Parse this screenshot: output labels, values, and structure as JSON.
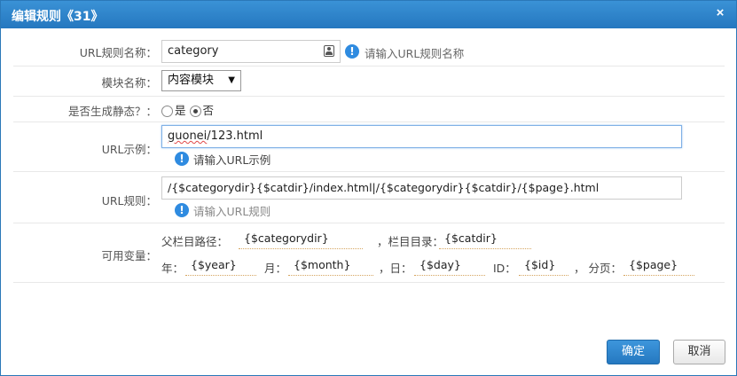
{
  "dialog": {
    "title": "编辑规则《31》",
    "close_label": "×"
  },
  "form": {
    "rule_name": {
      "label": "URL规则名称：",
      "value": "category",
      "hint": "请输入URL规则名称"
    },
    "module": {
      "label": "模块名称：",
      "selected": "内容模块",
      "arrow": "▼"
    },
    "static": {
      "label": "是否生成静态？：",
      "options": [
        "是",
        "否"
      ],
      "selected": "否"
    },
    "url_example": {
      "label": "URL示例：",
      "value_part1": "guonei",
      "value_part2": "/123.html",
      "hint": "请输入URL示例"
    },
    "url_rule": {
      "label": "URL规则：",
      "value": "/{$categorydir}{$catdir}/index.html|/{$categorydir}{$catdir}/{$page}.html",
      "hint": "请输入URL规则"
    },
    "variables": {
      "label": "可用变量：",
      "items": [
        {
          "label": "父栏目路径：",
          "value": "{$categorydir}"
        },
        {
          "label": "，栏目目录：",
          "value": "{$catdir}"
        },
        {
          "label": "年：",
          "value": "{$year}"
        },
        {
          "label": "月：",
          "value": "{$month}"
        },
        {
          "label": "，日：",
          "value": "{$day}"
        },
        {
          "label": "ID：",
          "value": "{$id}"
        },
        {
          "label": "， 分页：",
          "value": "{$page}"
        }
      ]
    }
  },
  "buttons": {
    "confirm": "确定",
    "cancel": "取消"
  },
  "colors": {
    "titlebar": "#2a7fc6",
    "primary_button": "#2f86cf",
    "info_icon": "#2f8be0"
  },
  "icons": {
    "rule_name_field": "contact-card-icon",
    "hints": "info-icon"
  }
}
